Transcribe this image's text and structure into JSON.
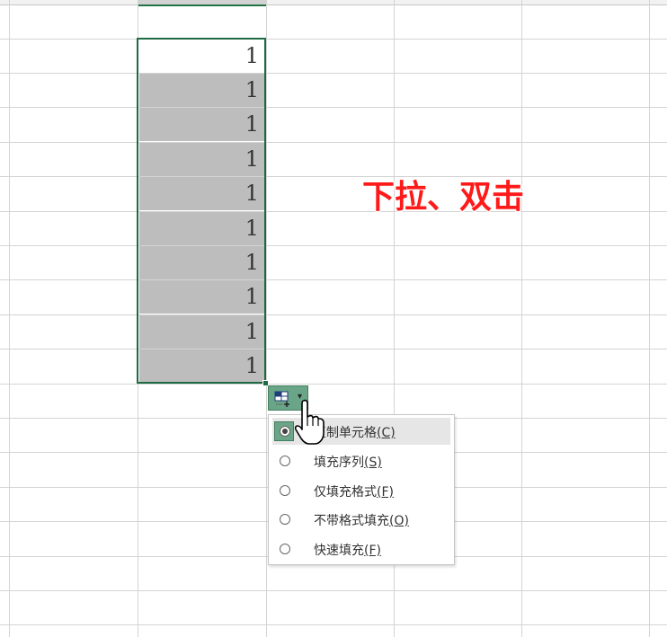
{
  "sheet": {
    "selected_values": [
      "1",
      "1",
      "1",
      "1",
      "1",
      "1",
      "1",
      "1",
      "1",
      "1"
    ]
  },
  "annotation": {
    "text": "下拉、双击",
    "color": "#ff1a1a"
  },
  "autofill_button": {
    "icon": "auto-fill-options-icon",
    "chevron": "▾"
  },
  "autofill_menu": {
    "items": [
      {
        "label": "复制单元格",
        "key": "(C)",
        "checked": true
      },
      {
        "label": "填充序列",
        "key": "(S)",
        "checked": false
      },
      {
        "label": "仅填充格式",
        "key": "(F)",
        "checked": false
      },
      {
        "label": "不带格式填充",
        "key": "(O)",
        "checked": false
      },
      {
        "label": "快速填充",
        "key": "(F)",
        "checked": false
      }
    ]
  },
  "colors": {
    "accent": "#217346",
    "selection": "#bdbdbd",
    "button": "#6aa587"
  }
}
